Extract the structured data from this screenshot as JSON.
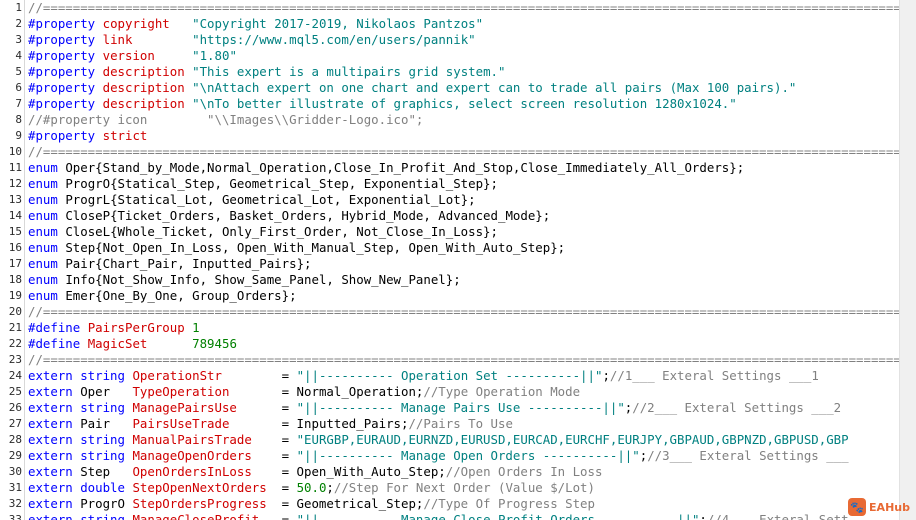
{
  "colors": {
    "directive": "#0000ff",
    "property_name": "#d00000",
    "string": "#008080",
    "comment": "#808080",
    "keyword": "#0000ff",
    "plain": "#000000",
    "number": "#008000",
    "identifier": "#d00000",
    "line_number": "#2b2b2b",
    "background": "#ffffff"
  },
  "lines": [
    {
      "n": "1",
      "tokens": [
        [
          "c",
          "//==============================================================================================================================================="
        ]
      ]
    },
    {
      "n": "2",
      "tokens": [
        [
          "k",
          "#property "
        ],
        [
          "r",
          "copyright"
        ],
        [
          "p",
          "   "
        ],
        [
          "s",
          "\"Copyright 2017-2019, Nikolaos Pantzos\""
        ]
      ]
    },
    {
      "n": "3",
      "tokens": [
        [
          "k",
          "#property "
        ],
        [
          "r",
          "link"
        ],
        [
          "p",
          "        "
        ],
        [
          "s",
          "\"https://www.mql5.com/en/users/pannik\""
        ]
      ]
    },
    {
      "n": "4",
      "tokens": [
        [
          "k",
          "#property "
        ],
        [
          "r",
          "version"
        ],
        [
          "p",
          "     "
        ],
        [
          "s",
          "\"1.80\""
        ]
      ]
    },
    {
      "n": "5",
      "tokens": [
        [
          "k",
          "#property "
        ],
        [
          "r",
          "description"
        ],
        [
          "p",
          " "
        ],
        [
          "s",
          "\"This expert is a multipairs grid system.\""
        ]
      ]
    },
    {
      "n": "6",
      "tokens": [
        [
          "k",
          "#property "
        ],
        [
          "r",
          "description"
        ],
        [
          "p",
          " "
        ],
        [
          "s",
          "\"\\nAttach expert on one chart and expert can to trade all pairs (Max 100 pairs).\""
        ]
      ]
    },
    {
      "n": "7",
      "tokens": [
        [
          "k",
          "#property "
        ],
        [
          "r",
          "description"
        ],
        [
          "p",
          " "
        ],
        [
          "s",
          "\"\\nTo better illustrate of graphics, select screen resolution 1280x1024.\""
        ]
      ]
    },
    {
      "n": "8",
      "tokens": [
        [
          "c",
          "//#property icon        \"\\\\Images\\\\Gridder-Logo.ico\";"
        ]
      ]
    },
    {
      "n": "9",
      "tokens": [
        [
          "k",
          "#property "
        ],
        [
          "r",
          "strict"
        ]
      ]
    },
    {
      "n": "10",
      "tokens": [
        [
          "c",
          "//==============================================================================================================================================="
        ]
      ]
    },
    {
      "n": "11",
      "tokens": [
        [
          "k",
          "enum "
        ],
        [
          "p",
          "Oper{Stand_by_Mode,Normal_Operation,Close_In_Profit_And_Stop,Close_Immediately_All_Orders};"
        ]
      ]
    },
    {
      "n": "12",
      "tokens": [
        [
          "k",
          "enum "
        ],
        [
          "p",
          "ProgrO{Statical_Step, Geometrical_Step, Exponential_Step};"
        ]
      ]
    },
    {
      "n": "13",
      "tokens": [
        [
          "k",
          "enum "
        ],
        [
          "p",
          "ProgrL{Statical_Lot, Geometrical_Lot, Exponential_Lot};"
        ]
      ]
    },
    {
      "n": "14",
      "tokens": [
        [
          "k",
          "enum "
        ],
        [
          "p",
          "CloseP{Ticket_Orders, Basket_Orders, Hybrid_Mode, Advanced_Mode};"
        ]
      ]
    },
    {
      "n": "15",
      "tokens": [
        [
          "k",
          "enum "
        ],
        [
          "p",
          "CloseL{Whole_Ticket, Only_First_Order, Not_Close_In_Loss};"
        ]
      ]
    },
    {
      "n": "16",
      "tokens": [
        [
          "k",
          "enum "
        ],
        [
          "p",
          "Step{Not_Open_In_Loss, Open_With_Manual_Step, Open_With_Auto_Step};"
        ]
      ]
    },
    {
      "n": "17",
      "tokens": [
        [
          "k",
          "enum "
        ],
        [
          "p",
          "Pair{Chart_Pair, Inputted_Pairs};"
        ]
      ]
    },
    {
      "n": "18",
      "tokens": [
        [
          "k",
          "enum "
        ],
        [
          "p",
          "Info{Not_Show_Info, Show_Same_Panel, Show_New_Panel};"
        ]
      ]
    },
    {
      "n": "19",
      "tokens": [
        [
          "k",
          "enum "
        ],
        [
          "p",
          "Emer{One_By_One, Group_Orders};"
        ]
      ]
    },
    {
      "n": "20",
      "tokens": [
        [
          "c",
          "//==============================================================================================================================================="
        ]
      ]
    },
    {
      "n": "21",
      "tokens": [
        [
          "k",
          "#define "
        ],
        [
          "r",
          "PairsPerGroup"
        ],
        [
          "p",
          " "
        ],
        [
          "g",
          "1"
        ]
      ]
    },
    {
      "n": "22",
      "tokens": [
        [
          "k",
          "#define "
        ],
        [
          "r",
          "MagicSet"
        ],
        [
          "p",
          "      "
        ],
        [
          "g",
          "789456"
        ]
      ]
    },
    {
      "n": "23",
      "tokens": [
        [
          "c",
          "//==============================================================================================================================================="
        ]
      ]
    },
    {
      "n": "24",
      "tokens": [
        [
          "k",
          "extern string "
        ],
        [
          "r",
          "OperationStr"
        ],
        [
          "p",
          "        = "
        ],
        [
          "s",
          "\"||---------- Operation Set ----------||\""
        ],
        [
          "p",
          ";"
        ],
        [
          "c",
          "//1___ Exteral Settings ___1"
        ]
      ]
    },
    {
      "n": "25",
      "tokens": [
        [
          "k",
          "extern "
        ],
        [
          "p",
          "Oper   "
        ],
        [
          "r",
          "TypeOperation"
        ],
        [
          "p",
          "       = Normal_Operation;"
        ],
        [
          "c",
          "//Type Operation Mode"
        ]
      ]
    },
    {
      "n": "26",
      "tokens": [
        [
          "k",
          "extern string "
        ],
        [
          "r",
          "ManagePairsUse"
        ],
        [
          "p",
          "      = "
        ],
        [
          "s",
          "\"||---------- Manage Pairs Use ----------||\""
        ],
        [
          "p",
          ";"
        ],
        [
          "c",
          "//2___ Exteral Settings ___2"
        ]
      ]
    },
    {
      "n": "27",
      "tokens": [
        [
          "k",
          "extern "
        ],
        [
          "p",
          "Pair   "
        ],
        [
          "r",
          "PairsUseTrade"
        ],
        [
          "p",
          "       = Inputted_Pairs;"
        ],
        [
          "c",
          "//Pairs To Use"
        ]
      ]
    },
    {
      "n": "28",
      "tokens": [
        [
          "k",
          "extern string "
        ],
        [
          "r",
          "ManualPairsTrade"
        ],
        [
          "p",
          "    = "
        ],
        [
          "s",
          "\"EURGBP,EURAUD,EURNZD,EURUSD,EURCAD,EURCHF,EURJPY,GBPAUD,GBPNZD,GBPUSD,GBP"
        ]
      ]
    },
    {
      "n": "29",
      "tokens": [
        [
          "k",
          "extern string "
        ],
        [
          "r",
          "ManageOpenOrders"
        ],
        [
          "p",
          "    = "
        ],
        [
          "s",
          "\"||---------- Manage Open Orders ----------||\""
        ],
        [
          "p",
          ";"
        ],
        [
          "c",
          "//3___ Exteral Settings ___"
        ]
      ]
    },
    {
      "n": "30",
      "tokens": [
        [
          "k",
          "extern "
        ],
        [
          "p",
          "Step   "
        ],
        [
          "r",
          "OpenOrdersInLoss"
        ],
        [
          "p",
          "    = Open_With_Auto_Step;"
        ],
        [
          "c",
          "//Open Orders In Loss"
        ]
      ]
    },
    {
      "n": "31",
      "tokens": [
        [
          "k",
          "extern double "
        ],
        [
          "r",
          "StepOpenNextOrders"
        ],
        [
          "p",
          "  = "
        ],
        [
          "g",
          "50.0"
        ],
        [
          "p",
          ";"
        ],
        [
          "c",
          "//Step For Next Order (Value $/Lot)"
        ]
      ]
    },
    {
      "n": "32",
      "tokens": [
        [
          "k",
          "extern "
        ],
        [
          "p",
          "ProgrO "
        ],
        [
          "r",
          "StepOrdersProgress"
        ],
        [
          "p",
          "  = Geometrical_Step;"
        ],
        [
          "c",
          "//Type Of Progress Step"
        ]
      ]
    },
    {
      "n": "33",
      "tokens": [
        [
          "k",
          "extern string "
        ],
        [
          "r",
          "ManageCloseProfit"
        ],
        [
          "p",
          "   = "
        ],
        [
          "s",
          "\"||---------- Manage Close Profit Orders ----------||\""
        ],
        [
          "p",
          ";"
        ],
        [
          "c",
          "//4___ Exteral Sett"
        ]
      ]
    }
  ],
  "watermark": {
    "logo_glyph": "🐾",
    "text": "EAHub",
    "color": "#e86a34"
  }
}
